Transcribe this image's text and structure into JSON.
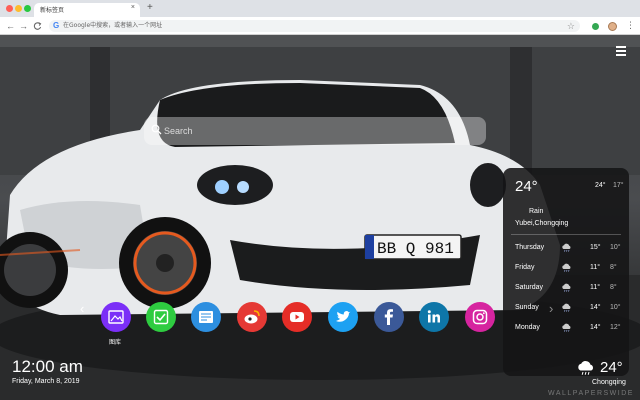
{
  "browser": {
    "tab_title": "新标签页",
    "tab_close": "×",
    "new_tab": "+",
    "nav": {
      "back": "←",
      "forward": "→",
      "reload": "C"
    },
    "address_placeholder": "在Google中搜索，或者输入一个网址",
    "star": "☆",
    "menu": "⋮"
  },
  "wallpaper": {
    "subject": "white sports car in garage",
    "plate": "BB Q 981",
    "watermark": "WALLPAPERSWIDE"
  },
  "search": {
    "placeholder": "Search"
  },
  "weather_panel": {
    "temp": "24°",
    "small_high": "24°",
    "small_low": "17°",
    "condition": "Rain",
    "location": "Yubei,Chongqing",
    "forecast": [
      {
        "day": "Thursday",
        "high": "15°",
        "low": "10°",
        "icon": "cloud-rain-icon"
      },
      {
        "day": "Friday",
        "high": "11°",
        "low": "8°",
        "icon": "cloud-rain-icon"
      },
      {
        "day": "Saturday",
        "high": "11°",
        "low": "8°",
        "icon": "cloud-rain-icon"
      },
      {
        "day": "Sunday",
        "high": "14°",
        "low": "10°",
        "icon": "cloud-rain-icon"
      },
      {
        "day": "Monday",
        "high": "14°",
        "low": "12°",
        "icon": "cloud-rain-icon"
      }
    ]
  },
  "dock": {
    "apps": [
      {
        "name": "gallery",
        "label": "图库",
        "color": "#7b2ff7"
      },
      {
        "name": "tasks",
        "label": "",
        "color": "#2ecc40"
      },
      {
        "name": "notes",
        "label": "",
        "color": "#2d8fe0"
      },
      {
        "name": "weibo",
        "label": "",
        "color": "#e53935"
      },
      {
        "name": "youtube",
        "label": "",
        "color": "#e52d27"
      },
      {
        "name": "twitter",
        "label": "",
        "color": "#1da1f2"
      },
      {
        "name": "facebook",
        "label": "",
        "color": "#3b5998"
      },
      {
        "name": "linkedin",
        "label": "",
        "color": "#0e76a8"
      },
      {
        "name": "instagram",
        "label": "",
        "color": "#d6249f"
      }
    ],
    "prev": "‹",
    "next": "›"
  },
  "clock": {
    "time": "12:00 am",
    "date": "Friday, March 8, 2019"
  },
  "current_weather": {
    "temp": "24°",
    "city": "Chongqing"
  }
}
